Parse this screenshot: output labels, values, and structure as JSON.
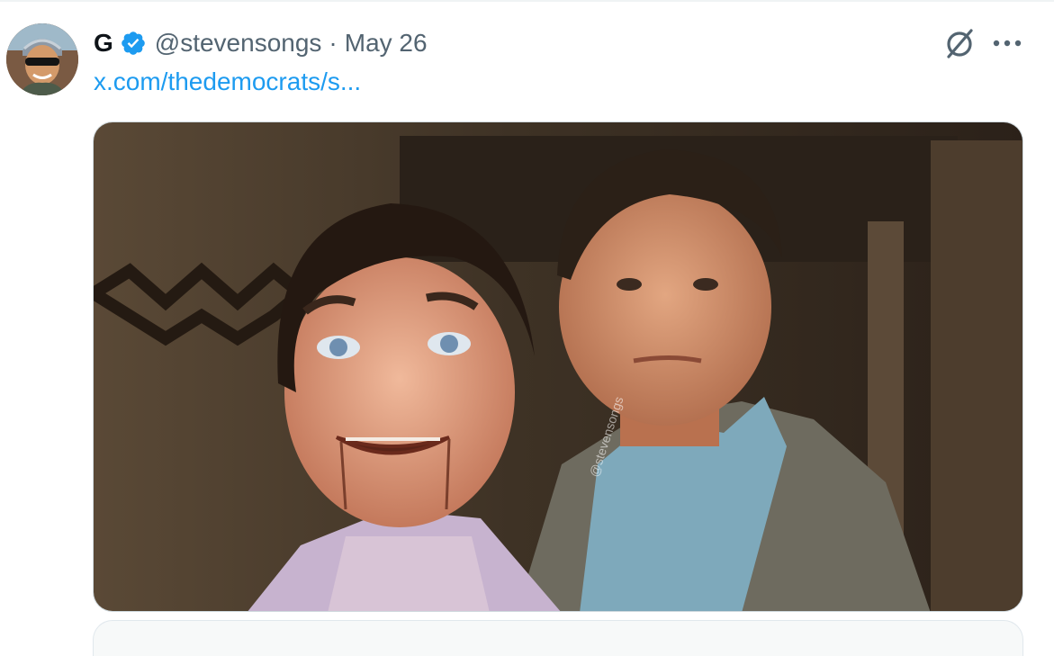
{
  "post": {
    "author": {
      "display_name": "G",
      "handle": "@stevensongs",
      "verified": true,
      "avatar_icon": "user-avatar"
    },
    "separator": "·",
    "date": "May 26",
    "link_text": "x.com/thedemocrats/s...",
    "media": {
      "watermark": "@stevensongs"
    }
  },
  "actions": {
    "grok_icon": "grok-icon",
    "more_icon": "more-options-icon"
  },
  "colors": {
    "accent": "#1d9bf0",
    "secondary_text": "#536471",
    "primary_text": "#0f1419",
    "border": "#cfd9de"
  }
}
